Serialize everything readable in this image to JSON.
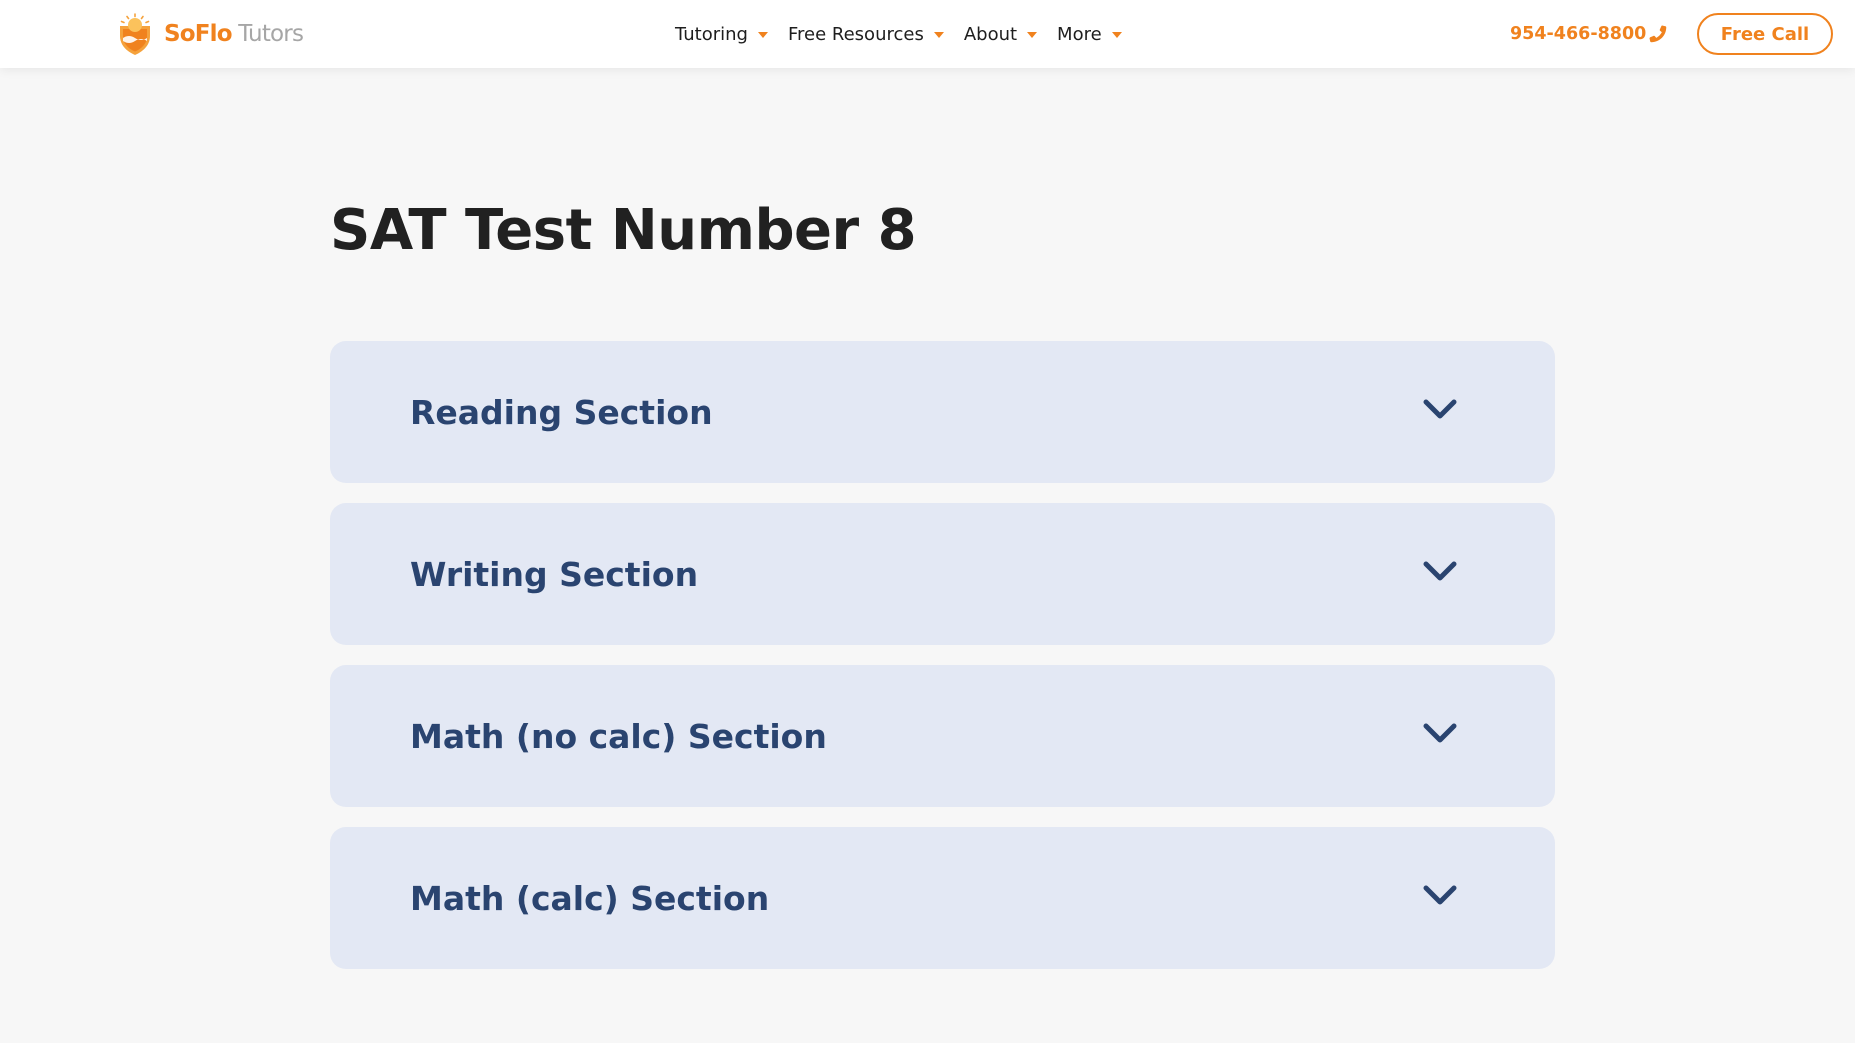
{
  "header": {
    "logo": {
      "brand_primary": "SoFlo",
      "brand_secondary": "Tutors",
      "icon": "sun-shield-logo-icon"
    },
    "nav": [
      {
        "label": "Tutoring",
        "icon": "chevron-down-icon"
      },
      {
        "label": "Free Resources",
        "icon": "chevron-down-icon"
      },
      {
        "label": "About",
        "icon": "chevron-down-icon"
      },
      {
        "label": "More",
        "icon": "chevron-down-icon"
      }
    ],
    "phone": {
      "number": "954-466-8800",
      "icon": "phone-icon"
    },
    "cta_label": "Free Call"
  },
  "main": {
    "title": "SAT Test Number 8",
    "sections": [
      {
        "label": "Reading Section",
        "icon": "chevron-down-icon"
      },
      {
        "label": "Writing Section",
        "icon": "chevron-down-icon"
      },
      {
        "label": "Math (no calc) Section",
        "icon": "chevron-down-icon"
      },
      {
        "label": "Math (calc) Section",
        "icon": "chevron-down-icon"
      }
    ]
  },
  "colors": {
    "accent": "#f0821e",
    "logo_gray": "#a6a6a6",
    "accordion_bg": "#e3e8f4",
    "accordion_text": "#2a4470",
    "page_bg": "#f7f7f7",
    "title_text": "#212121"
  }
}
